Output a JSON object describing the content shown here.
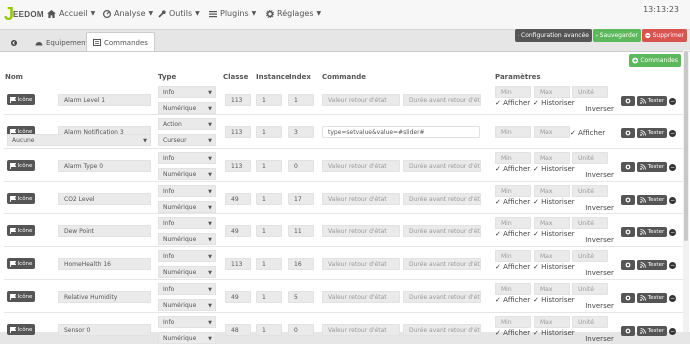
{
  "nav": {
    "logo_text": "EEDOM",
    "menus": [
      {
        "label": "Accueil"
      },
      {
        "label": "Analyse"
      },
      {
        "label": "Outils"
      },
      {
        "label": "Plugins"
      },
      {
        "label": "Réglages"
      }
    ],
    "clock": "13:13:23"
  },
  "tabs": [
    {
      "label": ""
    },
    {
      "label": "Equipement"
    },
    {
      "label": "Commandes"
    }
  ],
  "toolbar": {
    "config_label": "Configuration avancée",
    "save_label": "Sauvegarder",
    "delete_label": "Supprimer",
    "add_label": "Commandes"
  },
  "table": {
    "headers": {
      "nom": "Nom",
      "type": "Type",
      "classe": "Classe",
      "instance": "Instance",
      "index": "Index",
      "commande": "Commande",
      "parametres": "Paramètres"
    },
    "icon_label": "Icône",
    "test_label": "Tester",
    "placeholders": {
      "etat": "Valeur retour d'état",
      "duree": "Durée avant retour d'état (",
      "min": "Min",
      "max": "Max",
      "unite": "Unité"
    },
    "checkboxes": {
      "afficher": "Afficher",
      "historiser": "Historiser",
      "inverser": "Inverser"
    },
    "rows": [
      {
        "name": "Alarm Level 1",
        "type": "Info",
        "subtype": "Numérique",
        "classe": "113",
        "instance": "1",
        "index": "1",
        "kind": "info"
      },
      {
        "name": "Alarm Notification 3",
        "type": "Action",
        "subtype": "Curseur",
        "classe": "113",
        "instance": "1",
        "index": "3",
        "kind": "action",
        "extra_select": "Aucune",
        "command": "type=setvalue&value=#slider#"
      },
      {
        "name": "Alarm Type 0",
        "type": "Info",
        "subtype": "Numérique",
        "classe": "113",
        "instance": "1",
        "index": "0",
        "kind": "info"
      },
      {
        "name": "CO2 Level",
        "type": "Info",
        "subtype": "Numérique",
        "classe": "49",
        "instance": "1",
        "index": "17",
        "kind": "info"
      },
      {
        "name": "Dew Point",
        "type": "Info",
        "subtype": "Numérique",
        "classe": "49",
        "instance": "1",
        "index": "11",
        "kind": "info"
      },
      {
        "name": "HomeHealth 16",
        "type": "Info",
        "subtype": "Numérique",
        "classe": "113",
        "instance": "1",
        "index": "16",
        "kind": "info"
      },
      {
        "name": "Relative Humidity",
        "type": "Info",
        "subtype": "Numérique",
        "classe": "49",
        "instance": "1",
        "index": "5",
        "kind": "info"
      },
      {
        "name": "Sensor 0",
        "type": "Info",
        "subtype": "Numérique",
        "classe": "48",
        "instance": "1",
        "index": "0",
        "kind": "info"
      }
    ]
  },
  "colors": {
    "accent_green": "#5cb85c",
    "danger_red": "#d9534f",
    "dark_button": "#555555",
    "logo_green": "#94ca02"
  }
}
